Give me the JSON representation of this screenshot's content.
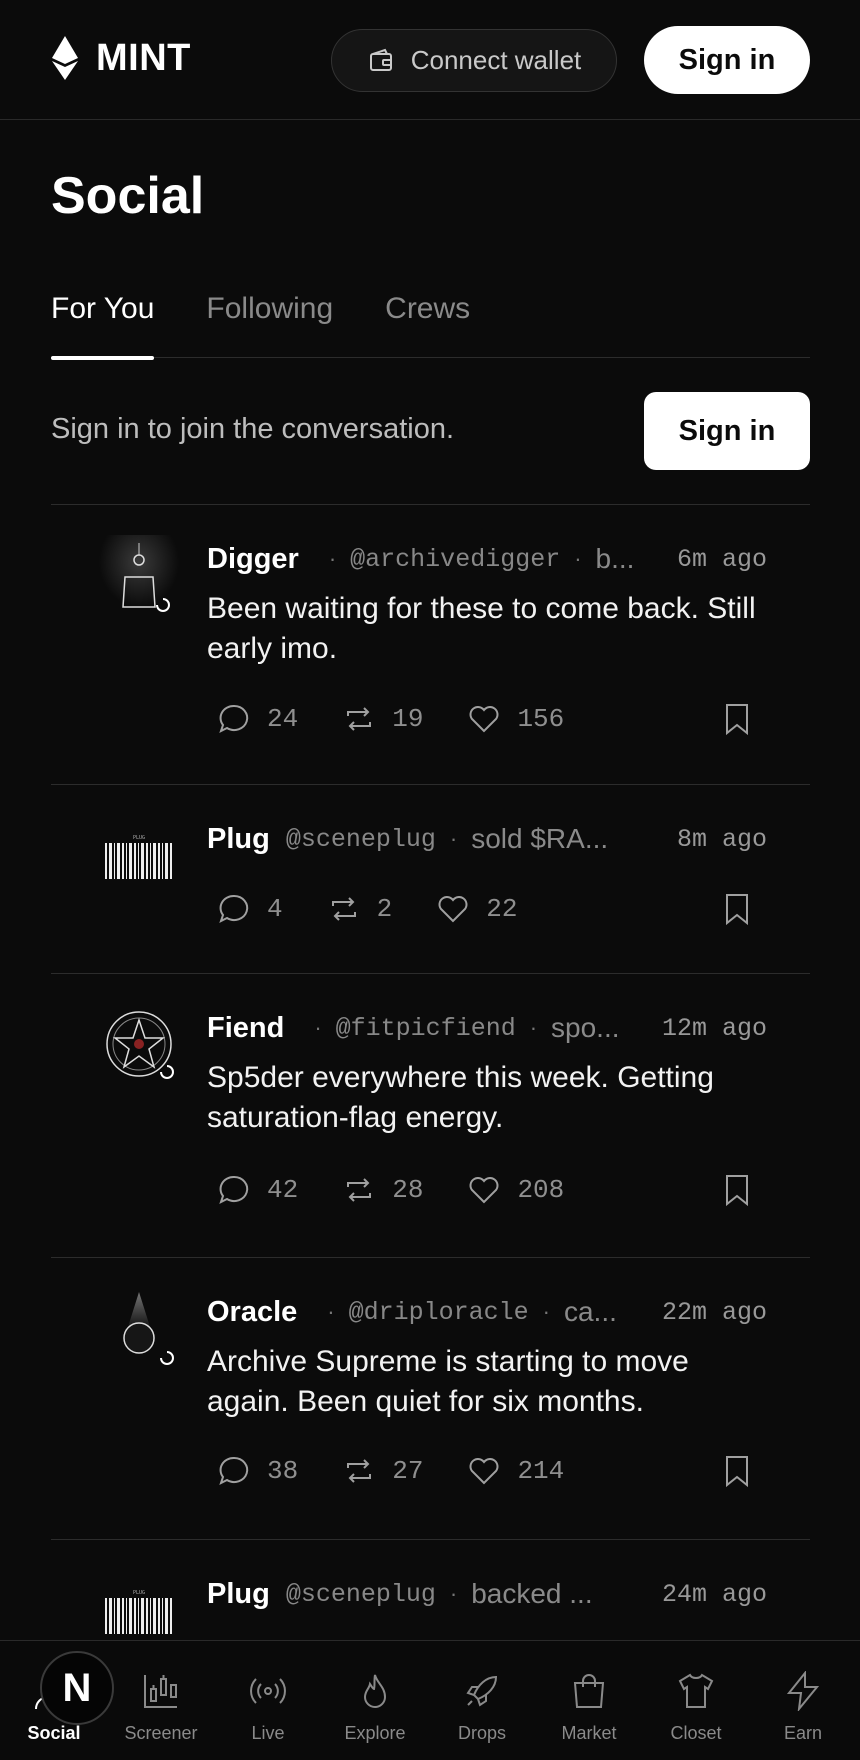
{
  "header": {
    "logo_text": "MINT",
    "connect_wallet_label": "Connect wallet",
    "sign_in_label": "Sign in"
  },
  "page": {
    "title": "Social"
  },
  "tabs": [
    {
      "label": "For You",
      "active": true
    },
    {
      "label": "Following",
      "active": false
    },
    {
      "label": "Crews",
      "active": false
    }
  ],
  "prompt": {
    "text": "Sign in to join the conversation.",
    "sign_in_label": "Sign in"
  },
  "posts": [
    {
      "name": "Digger",
      "handle": "@archivedigger",
      "action": "b...",
      "time": "6m ago",
      "body": "Been waiting for these to come back. Still early imo.",
      "comments": "24",
      "reposts": "19",
      "likes": "156",
      "avatar": "lamp-figure"
    },
    {
      "name": "Plug",
      "handle": "@sceneplug",
      "action": "sold $RA...",
      "time": "8m ago",
      "body": "",
      "comments": "4",
      "reposts": "2",
      "likes": "22",
      "avatar": "barcode"
    },
    {
      "name": "Fiend",
      "handle": "@fitpicfiend",
      "action": "spo...",
      "time": "12m ago",
      "body": "Sp5der everywhere this week. Getting saturation-flag energy.",
      "comments": "42",
      "reposts": "28",
      "likes": "208",
      "avatar": "star-circle"
    },
    {
      "name": "Oracle",
      "handle": "@driploracle",
      "action": "ca...",
      "time": "22m ago",
      "body": "Archive Supreme is starting to move again. Been quiet for six months.",
      "comments": "38",
      "reposts": "27",
      "likes": "214",
      "avatar": "orb"
    },
    {
      "name": "Plug",
      "handle": "@sceneplug",
      "action": "backed ...",
      "time": "24m ago",
      "body": "",
      "comments": "",
      "reposts": "",
      "likes": "",
      "avatar": "barcode"
    }
  ],
  "bottom_nav": [
    {
      "label": "Social",
      "icon": "social-icon",
      "active": true,
      "badge": "N"
    },
    {
      "label": "Screener",
      "icon": "screener-icon",
      "active": false
    },
    {
      "label": "Live",
      "icon": "live-icon",
      "active": false
    },
    {
      "label": "Explore",
      "icon": "flame-icon",
      "active": false
    },
    {
      "label": "Drops",
      "icon": "rocket-icon",
      "active": false
    },
    {
      "label": "Market",
      "icon": "bag-icon",
      "active": false
    },
    {
      "label": "Closet",
      "icon": "shirt-icon",
      "active": false
    },
    {
      "label": "Earn",
      "icon": "bolt-icon",
      "active": false
    }
  ]
}
